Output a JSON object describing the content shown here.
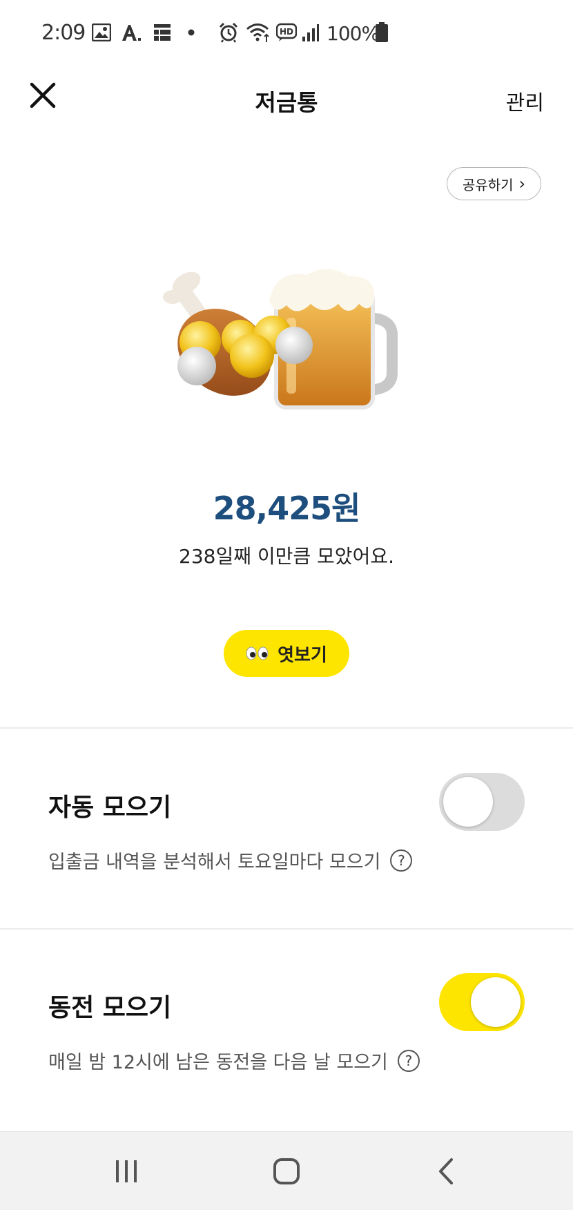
{
  "status_bar": {
    "time": "2:09",
    "battery_text": "100%",
    "icons": [
      "image-icon",
      "font-icon",
      "list-icon",
      "dot-icon",
      "alarm-icon",
      "wifi-icon",
      "hd-icon",
      "signal-icon",
      "battery-icon"
    ]
  },
  "header": {
    "title": "저금통",
    "manage_label": "관리"
  },
  "share": {
    "label": "공유하기",
    "arrow": "›"
  },
  "savings": {
    "amount": "28,425원",
    "message": "238일째 이만큼 모았어요."
  },
  "peek": {
    "label": "엿보기"
  },
  "auto_save": {
    "title": "자동 모으기",
    "description": "입출금 내역을 분석해서 토요일마다 모으기",
    "help": "?",
    "enabled": false
  },
  "coin_save": {
    "title": "동전 모으기",
    "description": "매일 밤 12시에 남은 동전을 다음 날 모으기",
    "help": "?",
    "enabled": true
  },
  "colors": {
    "accent_yellow": "#fde500",
    "amount_blue": "#1d4e7d",
    "toggle_off": "#dcdcdc"
  },
  "nav": {
    "icons": [
      "recent-apps-icon",
      "home-icon",
      "back-icon"
    ]
  }
}
